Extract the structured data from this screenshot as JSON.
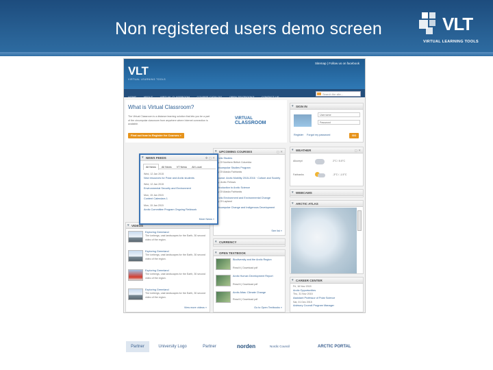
{
  "slide": {
    "title": "Non registered users demo screen",
    "logo_text": "VLT",
    "logo_sub": "VIRTUAL LEARNING TOOLS"
  },
  "site": {
    "logo": "VLT",
    "logo_sub": "VIRTUAL LEARNING TOOLS",
    "top_links": "Sitemap  |  Follow us on facebook",
    "nav": [
      "HOME",
      "ABOUT",
      "VIRTUAL CLASSROOM",
      "COURSE CATALOG",
      "OPEN TEXTBOOKS",
      "CONTACT US"
    ],
    "search_placeholder": "Search the site..."
  },
  "intro": {
    "heading": "What is Virtual Classroom?",
    "body": "The Virtual Classroom is a distance learning solution that lets you be a part of the circumpolar classroom from anywhere where Internet connection is available.",
    "cta": "Find out how to Register for Courses »",
    "vc_logo_line1": "VIRTUAL",
    "vc_logo_line2": "CLASSROOM"
  },
  "signin": {
    "title": "SIGN IN",
    "user_placeholder": "Username",
    "pass_placeholder": "Password",
    "register": "Register",
    "forgot": "Forgot my password",
    "go": "GO"
  },
  "news": {
    "title": "NEWS FEEDS",
    "tabs": [
      "All News",
      "All News",
      "VT News",
      "All Local"
    ],
    "items": [
      {
        "date": "Wed, 12 Jan 2015",
        "title": "New resources for Polar and Arctic students"
      },
      {
        "date": "Wed, 12 Jan 2015",
        "title": "Environmental Security and Environment"
      },
      {
        "date": "Mon, 15 Jan 2015",
        "title": "Content Calendars 1"
      },
      {
        "date": "Mon, 15 Jan 2015",
        "title": "Arctic Committee Program Ongoing Fieldwork"
      }
    ],
    "more": "More News »"
  },
  "courses": {
    "title": "UPCOMING COURSES",
    "items": [
      {
        "title": "Arctic Studies",
        "by": "By Of Northern British Columbia"
      },
      {
        "title": "Circumpolar Studies Program",
        "by": "By Of Alaska Fairbanks"
      },
      {
        "title": "Course: Arctic Mobility 2015-2016 · Culture and Society",
        "by": "By: Arctic Fellows"
      },
      {
        "title": "Introduction to Arctic Science",
        "by": "By Of Alaska Fairbanks"
      },
      {
        "title": "Arctic Environment and Environmental Change",
        "by": "By Of Lapland"
      },
      {
        "title": "Circumpolar Change and Indigenous Development",
        "by": "By University of Oulu"
      }
    ],
    "more": "See list »"
  },
  "weather": {
    "title": "WEATHER",
    "rows": [
      {
        "city": "Alkureyri",
        "temp": "2°C / 5.5°C"
      },
      {
        "city": "Fairbanks",
        "temp": "-3°C / -1.5°C"
      }
    ]
  },
  "webcam": {
    "title": "WEBCAMS"
  },
  "atlas": {
    "title": "ARCTIC ATLAS"
  },
  "videos": {
    "title": "VIDEOS",
    "items": [
      {
        "title": "Exploring Greenland",
        "desc": "The icebergs, vast landscapes for the Earth, 30 second video of the region."
      },
      {
        "title": "Exploring Greenland",
        "desc": "The icebergs, vast landscapes for the Earth, 30 second video of the region."
      },
      {
        "title": "Exploring Greenland",
        "desc": "The icebergs, vast landscapes for the Earth, 30 second video of the region."
      },
      {
        "title": "Exploring Greenland",
        "desc": "The icebergs, vast landscapes for the Earth, 30 second video of the region."
      }
    ],
    "more": "View more videos »"
  },
  "currency": {
    "title": "CURRENCY"
  },
  "textbook": {
    "title": "OPEN TEXTBOOK",
    "items": [
      {
        "title": "Biodiversity and the Arctic Region",
        "meta": "Read it | Download pdf"
      },
      {
        "title": "Arctic Human Development Report",
        "meta": "Read it | Download pdf"
      },
      {
        "title": "Arctic Atlas: Climate Change",
        "meta": "Read it | Download pdf"
      }
    ],
    "more": "Go to Open Textbooks »"
  },
  "careers": {
    "title": "CAREER CENTER",
    "items": [
      {
        "date": "Fri, 16 Nov 2015",
        "title": "Arctic Opportunities"
      },
      {
        "date": "Thu, 31 Nov 2015",
        "title": "Assistant Professor of Polar Science"
      },
      {
        "date": "Sat, 01 Dec 2015",
        "title": "Advisory Council Program Manager"
      }
    ]
  },
  "partners": [
    "Partner",
    "University Logo",
    "Partner",
    "norden",
    "Nordic Council",
    "ARCTIC PORTAL"
  ]
}
